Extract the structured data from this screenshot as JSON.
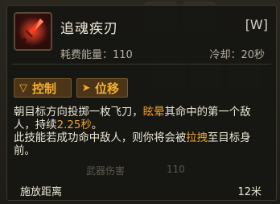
{
  "skill": {
    "name": "追魂疾刃",
    "hotkey": "[W]",
    "cost": "耗费能量：110",
    "cooldown": "冷却：20秒",
    "icon": "dagger-icon"
  },
  "tags": [
    {
      "icon": "control-icon",
      "glyph": "▽",
      "label": "控制"
    },
    {
      "icon": "displacement-icon",
      "glyph": "➤",
      "label": "位移"
    }
  ],
  "description": {
    "p1_a": "朝目标方向投掷一枚飞刀，",
    "p1_stun": "眩晕",
    "p1_b": "其命中的第一个敌人，持续",
    "p1_dur": "2.25秒",
    "p1_c": "。",
    "p2_a": "此技能若成功命中敌人，则你将会被",
    "p2_pull": "拉拽",
    "p2_b": "至目标身前。"
  },
  "background_row": {
    "label": "武器伤害",
    "value": "110"
  },
  "range": {
    "label": "施放距离",
    "value": "12米"
  },
  "colors": {
    "highlight": "#f2a12b",
    "tag_text": "#f3b02c"
  }
}
